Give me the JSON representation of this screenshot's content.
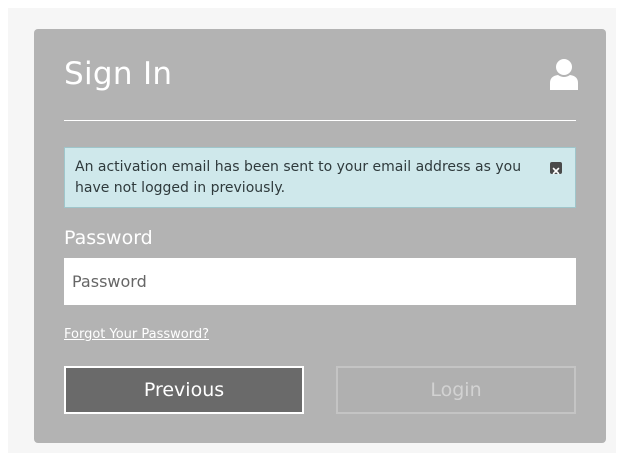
{
  "signin": {
    "title": "Sign In",
    "user_icon": "user-icon"
  },
  "alert": {
    "message": "An activation email has been sent to your email address as you have not logged in previously.",
    "close_icon": "close-icon",
    "background_color": "#cfe8eb"
  },
  "password": {
    "label": "Password",
    "placeholder": "Password",
    "value": ""
  },
  "links": {
    "forgot_password": "Forgot Your Password?"
  },
  "buttons": {
    "previous_label": "Previous",
    "login_label": "Login",
    "login_disabled": true
  },
  "colors": {
    "panel": "#b3b3b3",
    "primary_button": "#6a6a6a"
  }
}
